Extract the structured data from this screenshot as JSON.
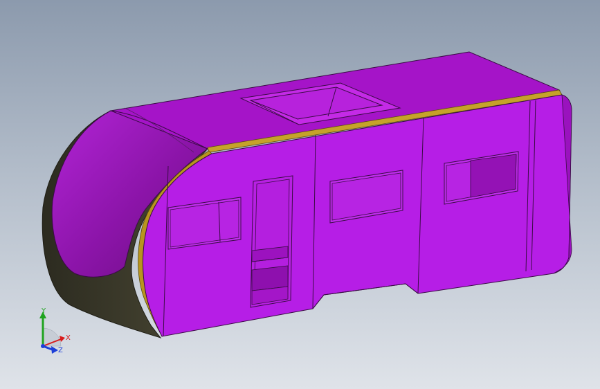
{
  "viewport": {
    "background_top": "#8c9aad",
    "background_bottom": "#dfe3e9"
  },
  "model": {
    "body_color": "#b61ee6",
    "body_shade_color": "#9c12bf",
    "trim_color": "#c6a22a",
    "base_color": "#3b3a2a",
    "edge_color": "#2a1030"
  },
  "triad": {
    "x_label": "X",
    "y_label": "Y",
    "z_label": "Z",
    "x_color": "#d81b1b",
    "y_color": "#1fa31f",
    "z_color": "#1c3fd8"
  }
}
